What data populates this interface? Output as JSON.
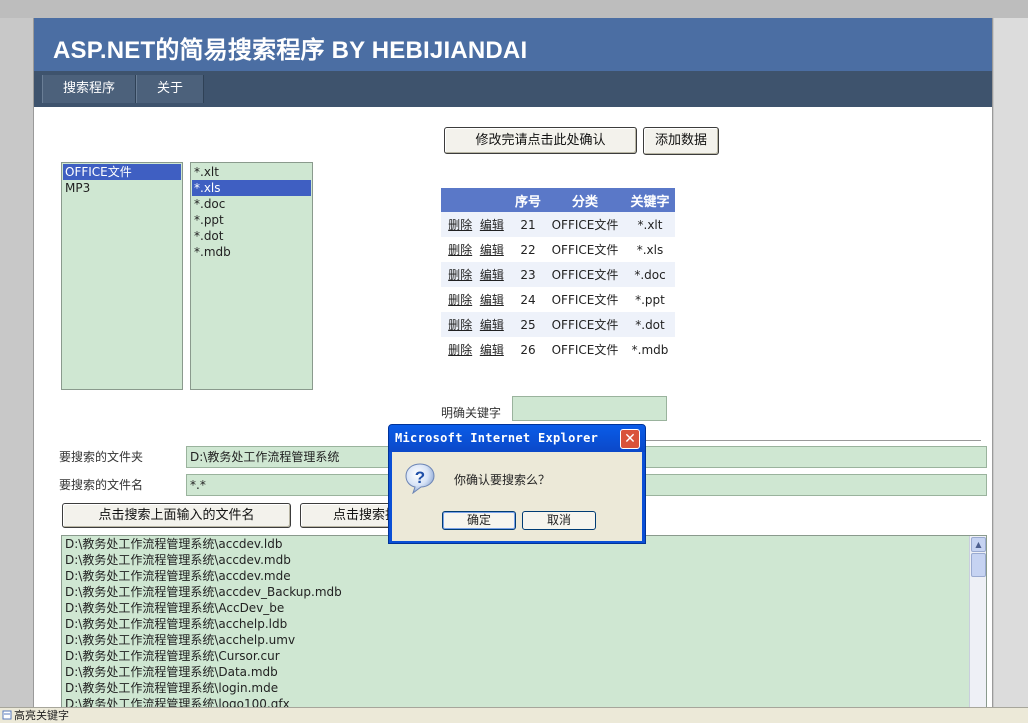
{
  "header": {
    "title": "ASP.NET的简易搜索程序  BY HEBIJIANDAI"
  },
  "nav": {
    "tabs": [
      "搜索程序",
      "关于"
    ]
  },
  "toolbar": {
    "confirm_button": "修改完请点击此处确认",
    "add_button": "添加数据"
  },
  "category_list": {
    "items": [
      "OFFICE文件",
      "MP3"
    ],
    "selected_index": 0
  },
  "extension_list": {
    "items": [
      "*.xlt",
      "*.xls",
      "*.doc",
      "*.ppt",
      "*.dot",
      "*.mdb"
    ],
    "selected_index": 1
  },
  "grid": {
    "columns": [
      "",
      "序号",
      "分类",
      "关键字"
    ],
    "delete_label": "删除",
    "edit_label": "编辑",
    "rows": [
      {
        "id": "21",
        "category": "OFFICE文件",
        "keyword": "*.xlt"
      },
      {
        "id": "22",
        "category": "OFFICE文件",
        "keyword": "*.xls"
      },
      {
        "id": "23",
        "category": "OFFICE文件",
        "keyword": "*.doc"
      },
      {
        "id": "24",
        "category": "OFFICE文件",
        "keyword": "*.ppt"
      },
      {
        "id": "25",
        "category": "OFFICE文件",
        "keyword": "*.dot"
      },
      {
        "id": "26",
        "category": "OFFICE文件",
        "keyword": "*.mdb"
      }
    ]
  },
  "keyword_field": {
    "label": "明确关键字",
    "value": ""
  },
  "search": {
    "folder_label": "要搜索的文件夹",
    "folder_value": "D:\\教务处工作流程管理系统",
    "filename_label": "要搜索的文件名",
    "filename_value": "*.*",
    "search_button": "点击搜索上面输入的文件名",
    "search_button2": "点击搜索指"
  },
  "results": [
    "D:\\教务处工作流程管理系统\\accdev.ldb",
    "D:\\教务处工作流程管理系统\\accdev.mdb",
    "D:\\教务处工作流程管理系统\\accdev.mde",
    "D:\\教务处工作流程管理系统\\accdev_Backup.mdb",
    "D:\\教务处工作流程管理系统\\AccDev_be",
    "D:\\教务处工作流程管理系统\\acchelp.ldb",
    "D:\\教务处工作流程管理系统\\acchelp.umv",
    "D:\\教务处工作流程管理系统\\Cursor.cur",
    "D:\\教务处工作流程管理系统\\Data.mdb",
    "D:\\教务处工作流程管理系统\\login.mde",
    "D:\\教务处工作流程管理系统\\logo100.gfx"
  ],
  "dialog": {
    "title": "Microsoft Internet Explorer",
    "message": "你确认要搜索么？",
    "ok": "确定",
    "cancel": "取消",
    "icon": "question-icon"
  },
  "statusbar": {
    "text": "高亮关键字"
  }
}
